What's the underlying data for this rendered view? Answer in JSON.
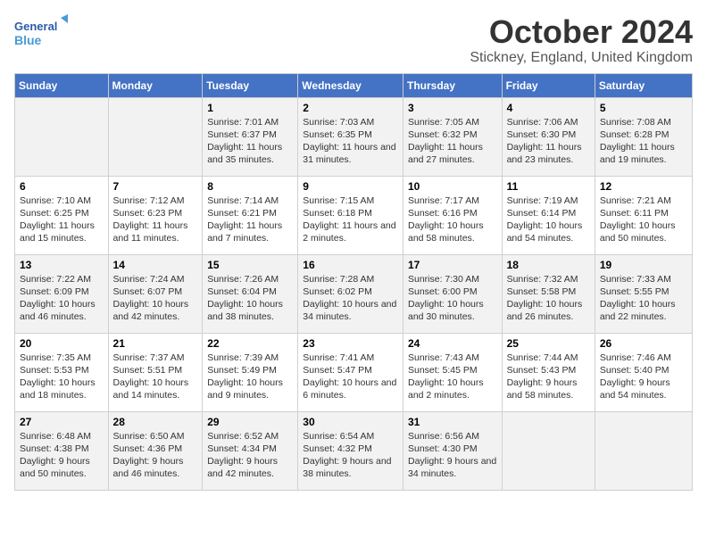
{
  "header": {
    "logo_line1": "General",
    "logo_line2": "Blue",
    "month": "October 2024",
    "location": "Stickney, England, United Kingdom"
  },
  "days": [
    "Sunday",
    "Monday",
    "Tuesday",
    "Wednesday",
    "Thursday",
    "Friday",
    "Saturday"
  ],
  "weeks": [
    [
      {
        "day": "",
        "content": ""
      },
      {
        "day": "",
        "content": ""
      },
      {
        "day": "1",
        "content": "Sunrise: 7:01 AM\nSunset: 6:37 PM\nDaylight: 11 hours and 35 minutes."
      },
      {
        "day": "2",
        "content": "Sunrise: 7:03 AM\nSunset: 6:35 PM\nDaylight: 11 hours and 31 minutes."
      },
      {
        "day": "3",
        "content": "Sunrise: 7:05 AM\nSunset: 6:32 PM\nDaylight: 11 hours and 27 minutes."
      },
      {
        "day": "4",
        "content": "Sunrise: 7:06 AM\nSunset: 6:30 PM\nDaylight: 11 hours and 23 minutes."
      },
      {
        "day": "5",
        "content": "Sunrise: 7:08 AM\nSunset: 6:28 PM\nDaylight: 11 hours and 19 minutes."
      }
    ],
    [
      {
        "day": "6",
        "content": "Sunrise: 7:10 AM\nSunset: 6:25 PM\nDaylight: 11 hours and 15 minutes."
      },
      {
        "day": "7",
        "content": "Sunrise: 7:12 AM\nSunset: 6:23 PM\nDaylight: 11 hours and 11 minutes."
      },
      {
        "day": "8",
        "content": "Sunrise: 7:14 AM\nSunset: 6:21 PM\nDaylight: 11 hours and 7 minutes."
      },
      {
        "day": "9",
        "content": "Sunrise: 7:15 AM\nSunset: 6:18 PM\nDaylight: 11 hours and 2 minutes."
      },
      {
        "day": "10",
        "content": "Sunrise: 7:17 AM\nSunset: 6:16 PM\nDaylight: 10 hours and 58 minutes."
      },
      {
        "day": "11",
        "content": "Sunrise: 7:19 AM\nSunset: 6:14 PM\nDaylight: 10 hours and 54 minutes."
      },
      {
        "day": "12",
        "content": "Sunrise: 7:21 AM\nSunset: 6:11 PM\nDaylight: 10 hours and 50 minutes."
      }
    ],
    [
      {
        "day": "13",
        "content": "Sunrise: 7:22 AM\nSunset: 6:09 PM\nDaylight: 10 hours and 46 minutes."
      },
      {
        "day": "14",
        "content": "Sunrise: 7:24 AM\nSunset: 6:07 PM\nDaylight: 10 hours and 42 minutes."
      },
      {
        "day": "15",
        "content": "Sunrise: 7:26 AM\nSunset: 6:04 PM\nDaylight: 10 hours and 38 minutes."
      },
      {
        "day": "16",
        "content": "Sunrise: 7:28 AM\nSunset: 6:02 PM\nDaylight: 10 hours and 34 minutes."
      },
      {
        "day": "17",
        "content": "Sunrise: 7:30 AM\nSunset: 6:00 PM\nDaylight: 10 hours and 30 minutes."
      },
      {
        "day": "18",
        "content": "Sunrise: 7:32 AM\nSunset: 5:58 PM\nDaylight: 10 hours and 26 minutes."
      },
      {
        "day": "19",
        "content": "Sunrise: 7:33 AM\nSunset: 5:55 PM\nDaylight: 10 hours and 22 minutes."
      }
    ],
    [
      {
        "day": "20",
        "content": "Sunrise: 7:35 AM\nSunset: 5:53 PM\nDaylight: 10 hours and 18 minutes."
      },
      {
        "day": "21",
        "content": "Sunrise: 7:37 AM\nSunset: 5:51 PM\nDaylight: 10 hours and 14 minutes."
      },
      {
        "day": "22",
        "content": "Sunrise: 7:39 AM\nSunset: 5:49 PM\nDaylight: 10 hours and 9 minutes."
      },
      {
        "day": "23",
        "content": "Sunrise: 7:41 AM\nSunset: 5:47 PM\nDaylight: 10 hours and 6 minutes."
      },
      {
        "day": "24",
        "content": "Sunrise: 7:43 AM\nSunset: 5:45 PM\nDaylight: 10 hours and 2 minutes."
      },
      {
        "day": "25",
        "content": "Sunrise: 7:44 AM\nSunset: 5:43 PM\nDaylight: 9 hours and 58 minutes."
      },
      {
        "day": "26",
        "content": "Sunrise: 7:46 AM\nSunset: 5:40 PM\nDaylight: 9 hours and 54 minutes."
      }
    ],
    [
      {
        "day": "27",
        "content": "Sunrise: 6:48 AM\nSunset: 4:38 PM\nDaylight: 9 hours and 50 minutes."
      },
      {
        "day": "28",
        "content": "Sunrise: 6:50 AM\nSunset: 4:36 PM\nDaylight: 9 hours and 46 minutes."
      },
      {
        "day": "29",
        "content": "Sunrise: 6:52 AM\nSunset: 4:34 PM\nDaylight: 9 hours and 42 minutes."
      },
      {
        "day": "30",
        "content": "Sunrise: 6:54 AM\nSunset: 4:32 PM\nDaylight: 9 hours and 38 minutes."
      },
      {
        "day": "31",
        "content": "Sunrise: 6:56 AM\nSunset: 4:30 PM\nDaylight: 9 hours and 34 minutes."
      },
      {
        "day": "",
        "content": ""
      },
      {
        "day": "",
        "content": ""
      }
    ]
  ]
}
